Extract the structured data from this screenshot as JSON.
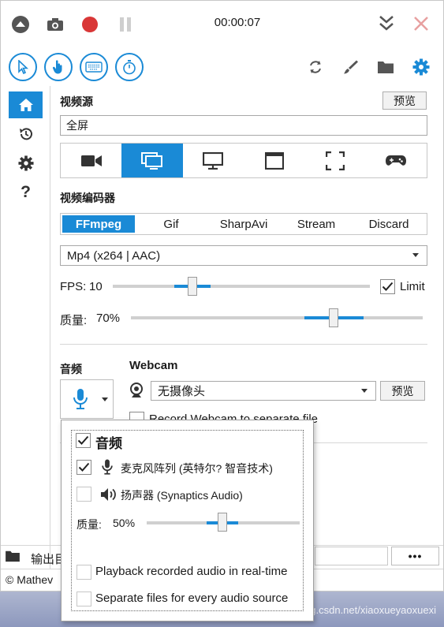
{
  "titlebar": {
    "timer": "00:00:07",
    "icons": [
      "collapse-icon",
      "camera-icon",
      "record-icon",
      "pause-icon",
      "minimize-icon",
      "close-icon"
    ]
  },
  "toolbar": {
    "left_icons": [
      "cursor-icon",
      "hand-icon",
      "keyboard-icon",
      "stopwatch-icon"
    ],
    "right_icons": [
      "refresh-icon",
      "brush-icon",
      "folder-icon",
      "gear-icon"
    ]
  },
  "sidebar": {
    "items": [
      "home-icon",
      "history-icon",
      "gear-icon",
      "help-icon"
    ],
    "help_label": "?"
  },
  "video_source": {
    "label": "视频源",
    "preview_label": "预览",
    "value": "全屏",
    "modes": [
      "camera-icon",
      "screen-region-icon",
      "monitor-icon",
      "window-icon",
      "fullscreen-icon",
      "gamepad-icon"
    ],
    "active_mode": 1
  },
  "video_encoder": {
    "label": "视频编码器",
    "tabs": [
      "FFmpeg",
      "Gif",
      "SharpAvi",
      "Stream",
      "Discard"
    ],
    "active_tab": 0,
    "codec": "Mp4 (x264 | AAC)",
    "fps_label": "FPS:",
    "fps_value": "10",
    "limit_label": "Limit",
    "limit_checked": true,
    "quality_label": "质量:",
    "quality_value": "70%"
  },
  "audio": {
    "label": "音频"
  },
  "webcam": {
    "label": "Webcam",
    "device": "无摄像头",
    "preview_label": "预览",
    "separate_file_label": "Record Webcam to separate file"
  },
  "audio_popup": {
    "header": "音频",
    "header_checked": true,
    "sources": [
      {
        "label": "麦克风阵列 (英特尔? 智音技术)",
        "checked": true,
        "icon": "microphone-icon"
      },
      {
        "label": "扬声器 (Synaptics Audio)",
        "checked": false,
        "icon": "speaker-icon"
      }
    ],
    "quality_label": "质量:",
    "quality_value": "50%",
    "playback_label": "Playback recorded audio in real-time",
    "separate_files_label": "Separate files for every audio source"
  },
  "footer": {
    "output_label": "输出目",
    "more_label": "•••",
    "copyright": "© Mathev"
  },
  "watermark": "https://blog.csdn.net/xiaoxueyaoxuexi",
  "colors": {
    "accent": "#1a8ad6",
    "record": "#d93737",
    "close": "#e8a0a0"
  }
}
